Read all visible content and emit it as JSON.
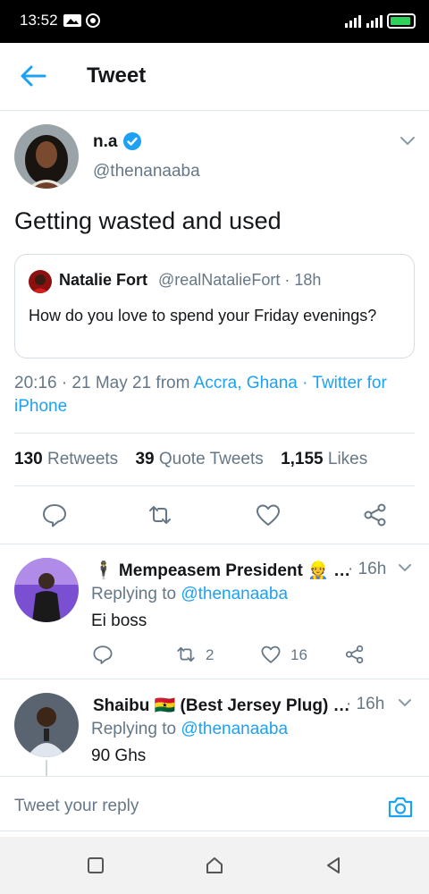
{
  "status_bar": {
    "time": "13:52",
    "battery_color": "#30d158"
  },
  "header": {
    "title": "Tweet",
    "back_icon": "arrow-left-icon"
  },
  "tweet": {
    "author_name": "n.a",
    "author_handle": "@thenanaaba",
    "text": "Getting wasted and used",
    "quote": {
      "author_name": "Natalie Fort",
      "author_handle": "@realNatalieFort · 18h",
      "text": "How do you love to spend your Friday evenings?"
    },
    "meta": {
      "time": "20:16 · 21 May 21 from ",
      "location": "Accra, Ghana",
      "separator": " · ",
      "source": "Twitter for iPhone"
    },
    "stats": {
      "retweets_count": "130",
      "retweets_label": "Retweets",
      "quotes_count": "39",
      "quotes_label": "Quote Tweets",
      "likes_count": "1,155",
      "likes_label": "Likes"
    }
  },
  "replies": [
    {
      "name": "🕴 Mempeasem President 👷 …",
      "time": "· 16h",
      "replying_prefix": "Replying to ",
      "replying_handle": "@thenanaaba",
      "text": "Ei boss",
      "retweet_count": "2",
      "like_count": "16"
    },
    {
      "name": "Shaibu 🇬🇭 (Best Jersey Plug) …",
      "time": "· 16h",
      "replying_prefix": "Replying to ",
      "replying_handle": "@thenanaaba",
      "text": "90 Ghs"
    }
  ],
  "composer": {
    "placeholder": "Tweet your reply"
  },
  "colors": {
    "accent": "#1da1f2",
    "text": "#14171a",
    "secondary": "#657786",
    "border": "#e1e8ed"
  }
}
